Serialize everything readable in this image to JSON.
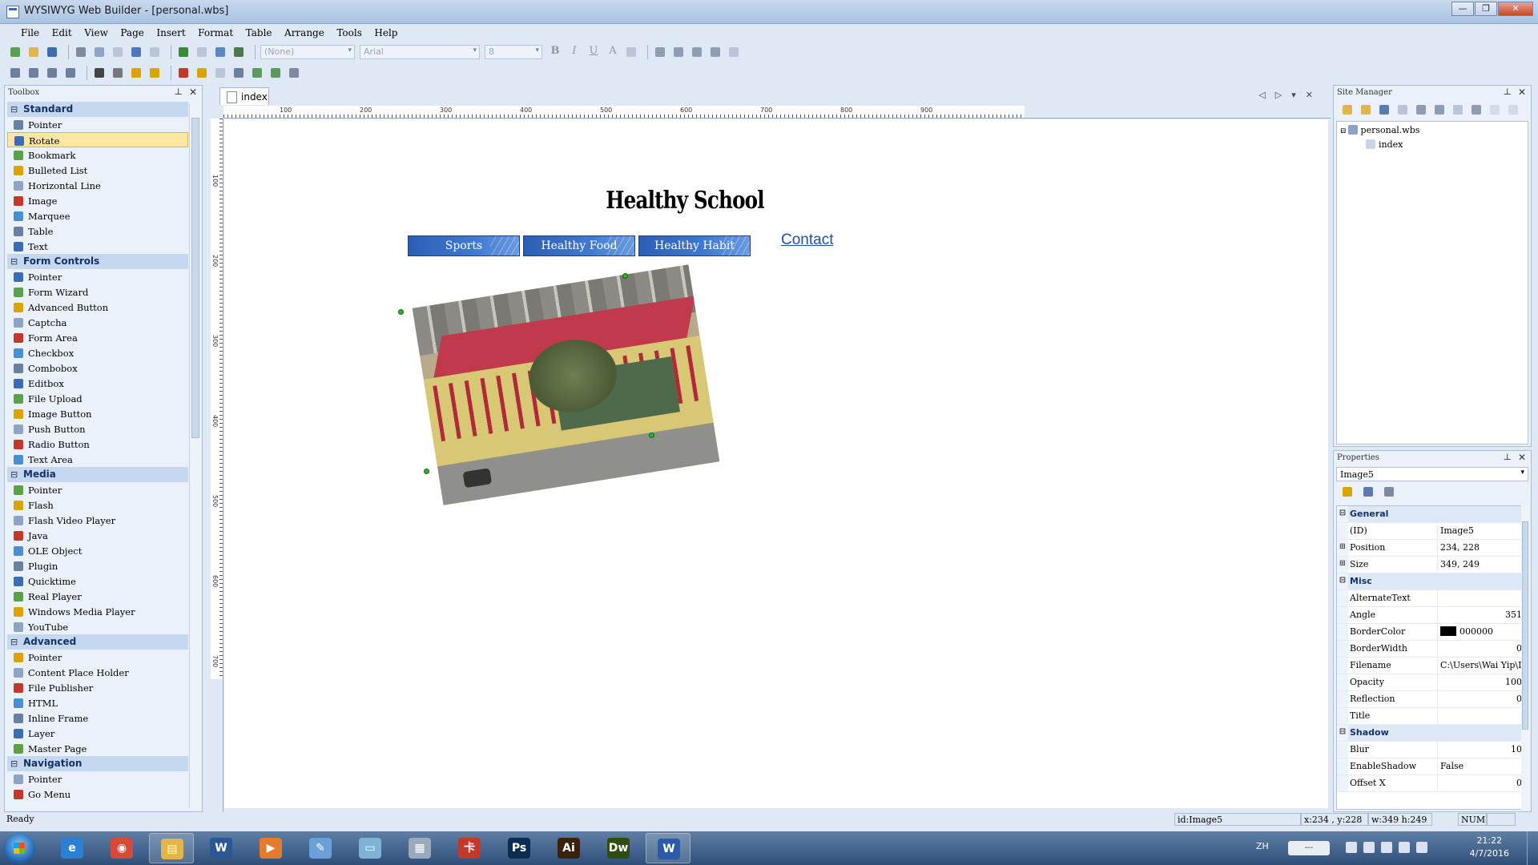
{
  "window": {
    "title": "WYSIWYG Web Builder - [personal.wbs]",
    "min": "—",
    "max": "❐",
    "close": "✕"
  },
  "menu": [
    "File",
    "Edit",
    "View",
    "Page",
    "Insert",
    "Format",
    "Table",
    "Arrange",
    "Tools",
    "Help"
  ],
  "format_bar": {
    "style": "(None)",
    "font": "Arial",
    "size": "8",
    "bold": "B",
    "italic": "I",
    "underline": "U",
    "text_color": "A"
  },
  "toolbox": {
    "title": "Toolbox",
    "groups": [
      {
        "name": "Standard",
        "items": [
          "Pointer",
          "Rotate",
          "Bookmark",
          "Bulleted List",
          "Horizontal Line",
          "Image",
          "Marquee",
          "Table",
          "Text"
        ]
      },
      {
        "name": "Form Controls",
        "items": [
          "Pointer",
          "Form Wizard",
          "Advanced Button",
          "Captcha",
          "Form Area",
          "Checkbox",
          "Combobox",
          "Editbox",
          "File Upload",
          "Image Button",
          "Push Button",
          "Radio Button",
          "Text Area"
        ]
      },
      {
        "name": "Media",
        "items": [
          "Pointer",
          "Flash",
          "Flash Video Player",
          "Java",
          "OLE Object",
          "Plugin",
          "Quicktime",
          "Real Player",
          "Windows Media Player",
          "YouTube"
        ]
      },
      {
        "name": "Advanced",
        "items": [
          "Pointer",
          "Content Place Holder",
          "File Publisher",
          "HTML",
          "Inline Frame",
          "Layer",
          "Master Page"
        ]
      },
      {
        "name": "Navigation",
        "items": [
          "Pointer",
          "Go Menu"
        ]
      }
    ],
    "selected": "Rotate"
  },
  "document": {
    "tab": "index",
    "ruler_h": [
      "100",
      "200",
      "300",
      "400",
      "500",
      "600",
      "700",
      "800",
      "900"
    ],
    "ruler_v": [
      "100",
      "200",
      "300",
      "400",
      "500",
      "600",
      "700"
    ],
    "page_title": "Healthy School",
    "nav_buttons": [
      "Sports",
      "Healthy Food",
      "Healthy Habit"
    ],
    "contact": "Contact"
  },
  "site_manager": {
    "title": "Site Manager",
    "project": "personal.wbs",
    "pages": [
      "index"
    ]
  },
  "properties": {
    "title": "Properties",
    "object": "Image5",
    "rows": [
      {
        "type": "cat",
        "name": "General"
      },
      {
        "name": "(ID)",
        "value": "Image5"
      },
      {
        "name": "Position",
        "value": "234, 228",
        "exp": "+"
      },
      {
        "name": "Size",
        "value": "349, 249",
        "exp": "+"
      },
      {
        "type": "cat",
        "name": "Misc"
      },
      {
        "name": "AlternateText",
        "value": ""
      },
      {
        "name": "Angle",
        "value": "351",
        "num": true
      },
      {
        "name": "BorderColor",
        "value": "000000",
        "swatch": "#000000"
      },
      {
        "name": "BorderWidth",
        "value": "0",
        "num": true
      },
      {
        "name": "Filename",
        "value": "C:\\Users\\Wai Yip\\Desk"
      },
      {
        "name": "Opacity",
        "value": "100",
        "num": true
      },
      {
        "name": "Reflection",
        "value": "0",
        "num": true
      },
      {
        "name": "Title",
        "value": ""
      },
      {
        "type": "cat",
        "name": "Shadow"
      },
      {
        "name": "Blur",
        "value": "10",
        "num": true
      },
      {
        "name": "EnableShadow",
        "value": "False"
      },
      {
        "name": "Offset X",
        "value": "0",
        "num": true
      }
    ]
  },
  "status": {
    "ready": "Ready",
    "id": "id:Image5",
    "pos": "x:234 , y:228",
    "size": "w:349 h:249",
    "num": "NUM"
  },
  "taskbar": {
    "apps": [
      {
        "name": "internet-explorer",
        "glyph": "e",
        "color": "#2a7fd6"
      },
      {
        "name": "chrome",
        "glyph": "◉",
        "color": "#d64a3a"
      },
      {
        "name": "file-explorer",
        "glyph": "▤",
        "color": "#e2b54c"
      },
      {
        "name": "word-doc",
        "glyph": "W",
        "color": "#2b5797"
      },
      {
        "name": "media-player",
        "glyph": "▶",
        "color": "#e37b2b"
      },
      {
        "name": "paint",
        "glyph": "✎",
        "color": "#6aa0d8"
      },
      {
        "name": "notepad",
        "glyph": "▭",
        "color": "#7fb3d5"
      },
      {
        "name": "calculator",
        "glyph": "▦",
        "color": "#9aa9bb"
      },
      {
        "name": "app-red",
        "glyph": "卡",
        "color": "#c0392b"
      },
      {
        "name": "photoshop",
        "glyph": "Ps",
        "color": "#0b2d4f"
      },
      {
        "name": "illustrator",
        "glyph": "Ai",
        "color": "#3a2108"
      },
      {
        "name": "dreamweaver",
        "glyph": "Dw",
        "color": "#2e4d0f"
      },
      {
        "name": "web-builder",
        "glyph": "W",
        "color": "#2d5aa6"
      }
    ],
    "lang": "ZH",
    "ime": "---",
    "time": "21:22",
    "date": "4/7/2016"
  }
}
